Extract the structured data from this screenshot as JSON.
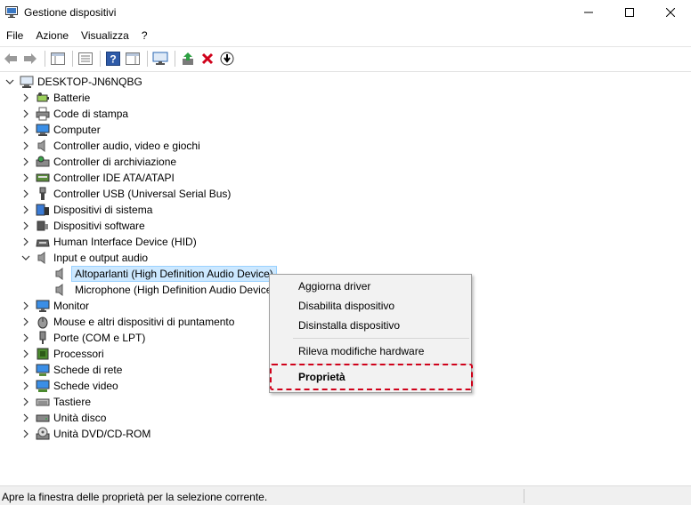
{
  "window": {
    "title": "Gestione dispositivi"
  },
  "menu": [
    "File",
    "Azione",
    "Visualizza",
    "?"
  ],
  "toolbar": {
    "buttons": [
      "back-arrow-icon",
      "forward-arrow-icon",
      "console-tree-icon",
      "properties-icon",
      "help-icon",
      "action-pane-icon",
      "monitor-scan-icon",
      "update-driver-icon",
      "uninstall-x-icon",
      "download-driver-icon"
    ]
  },
  "tree": {
    "root": "DESKTOP-JN6NQBG",
    "items": [
      {
        "label": "Batterie",
        "icon": "battery-icon"
      },
      {
        "label": "Code di stampa",
        "icon": "printer-icon"
      },
      {
        "label": "Computer",
        "icon": "computer-icon"
      },
      {
        "label": "Controller audio, video e giochi",
        "icon": "speaker-icon"
      },
      {
        "label": "Controller di archiviazione",
        "icon": "storage-icon"
      },
      {
        "label": "Controller IDE ATA/ATAPI",
        "icon": "ide-icon"
      },
      {
        "label": "Controller USB (Universal Serial Bus)",
        "icon": "usb-icon"
      },
      {
        "label": "Dispositivi di sistema",
        "icon": "system-icon"
      },
      {
        "label": "Dispositivi software",
        "icon": "software-icon"
      },
      {
        "label": "Human Interface Device (HID)",
        "icon": "hid-icon"
      },
      {
        "label": "Input e output audio",
        "icon": "speaker-icon",
        "expanded": true
      },
      {
        "label": "Monitor",
        "icon": "monitor-icon"
      },
      {
        "label": "Mouse e altri dispositivi di puntamento",
        "icon": "mouse-icon"
      },
      {
        "label": "Porte (COM e LPT)",
        "icon": "port-icon"
      },
      {
        "label": "Processori",
        "icon": "cpu-icon"
      },
      {
        "label": "Schede di rete",
        "icon": "network-icon"
      },
      {
        "label": "Schede video",
        "icon": "display-adapter-icon"
      },
      {
        "label": "Tastiere",
        "icon": "keyboard-icon"
      },
      {
        "label": "Unità disco",
        "icon": "disk-icon"
      },
      {
        "label": "Unità DVD/CD-ROM",
        "icon": "dvd-icon"
      }
    ],
    "audio_children": [
      {
        "label": "Altoparlanti (High Definition Audio Device)",
        "selected": true
      },
      {
        "label": "Microphone (High Definition Audio Device)"
      }
    ]
  },
  "context_menu": {
    "items": [
      "Aggiorna driver",
      "Disabilita dispositivo",
      "Disinstalla dispositivo",
      "Rileva modifiche hardware",
      "Proprietà"
    ],
    "highlight_color": "#d0021b"
  },
  "status": {
    "text": "Apre la finestra delle proprietà per la selezione corrente."
  }
}
